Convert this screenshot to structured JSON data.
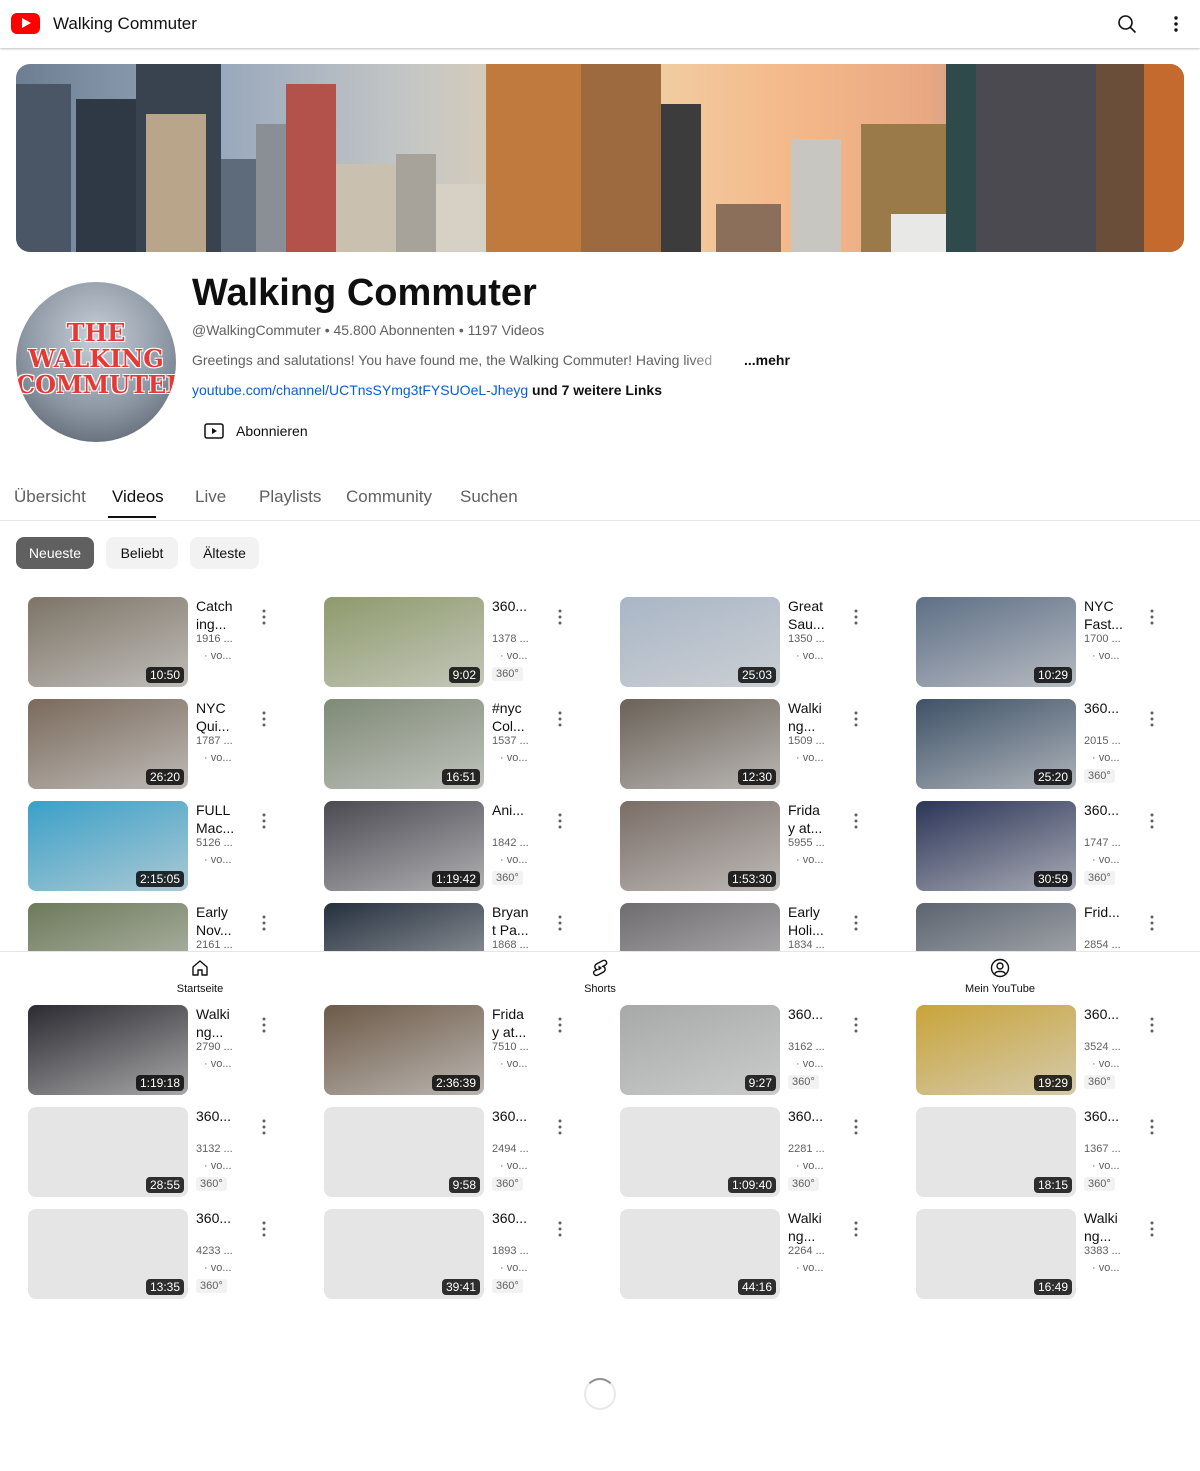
{
  "topbar": {
    "title": "Walking Commuter",
    "logo_icon": "youtube-logo-icon"
  },
  "channel": {
    "avatar_text": [
      "THE",
      "WALKING",
      "COMMUTER"
    ],
    "name": "Walking Commuter",
    "meta": "@WalkingCommuter • 45.800 Abonnenten • 1197 Videos",
    "description": "Greetings and salutations! You have found me, the Walking Commuter! Having lived",
    "more_label": "...mehr",
    "link_url": "youtube.com/channel/UCTnsSYmg3tFYSUOeL-Jheyg",
    "link_more": " und 7 weitere Links",
    "subscribe_label": "Abonnieren"
  },
  "tabs": [
    "Übersicht",
    "Videos",
    "Live",
    "Playlists",
    "Community",
    "Suchen"
  ],
  "active_tab": "Videos",
  "chips": [
    "Neueste",
    "Beliebt",
    "Älteste"
  ],
  "active_chip": "Neueste",
  "videos": [
    {
      "title": "Catch\ning...",
      "views": "1916 ...",
      "sub": "· vo...",
      "duration": "10:50",
      "badge": ""
    },
    {
      "title": "360...",
      "views": "1378 ...",
      "sub": "· vo...",
      "duration": "9:02",
      "badge": "360°"
    },
    {
      "title": "Great\nSau...",
      "views": "1350 ...",
      "sub": "· vo...",
      "duration": "25:03",
      "badge": ""
    },
    {
      "title": "NYC\nFast...",
      "views": "1700 ...",
      "sub": "· vo...",
      "duration": "10:29",
      "badge": ""
    },
    {
      "title": "NYC\nQui...",
      "views": "1787 ...",
      "sub": "· vo...",
      "duration": "26:20",
      "badge": ""
    },
    {
      "title": "#nyc\nCol...",
      "views": "1537 ...",
      "sub": "· vo...",
      "duration": "16:51",
      "badge": ""
    },
    {
      "title": "Walki\nng...",
      "views": "1509 ...",
      "sub": "· vo...",
      "duration": "12:30",
      "badge": ""
    },
    {
      "title": "360...",
      "views": "2015 ...",
      "sub": "· vo...",
      "duration": "25:20",
      "badge": "360°"
    },
    {
      "title": "FULL\nMac...",
      "views": "5126 ...",
      "sub": "· vo...",
      "duration": "2:15:05",
      "badge": ""
    },
    {
      "title": "Ani...",
      "views": "1842 ...",
      "sub": "· vo...",
      "duration": "1:19:42",
      "badge": "360°"
    },
    {
      "title": "Frida\ny at...",
      "views": "5955 ...",
      "sub": "· vo...",
      "duration": "1:53:30",
      "badge": ""
    },
    {
      "title": "360...",
      "views": "1747 ...",
      "sub": "· vo...",
      "duration": "30:59",
      "badge": "360°"
    },
    {
      "title": "Early\nNov...",
      "views": "2161 ...",
      "sub": "",
      "duration": "",
      "badge": ""
    },
    {
      "title": "Bryan\nt Pa...",
      "views": "1868 ...",
      "sub": "",
      "duration": "",
      "badge": ""
    },
    {
      "title": "Early\nHoli...",
      "views": "1834 ...",
      "sub": "",
      "duration": "",
      "badge": ""
    },
    {
      "title": "Frid...",
      "views": "2854 ...",
      "sub": "· vo...",
      "duration": "",
      "badge": ""
    },
    {
      "title": "Walki\nng...",
      "views": "2790 ...",
      "sub": "· vo...",
      "duration": "1:19:18",
      "badge": ""
    },
    {
      "title": "Frida\ny at...",
      "views": "7510 ...",
      "sub": "· vo...",
      "duration": "2:36:39",
      "badge": ""
    },
    {
      "title": "360...",
      "views": "3162 ...",
      "sub": "· vo...",
      "duration": "9:27",
      "badge": "360°"
    },
    {
      "title": "360...",
      "views": "3524 ...",
      "sub": "· vo...",
      "duration": "19:29",
      "badge": "360°"
    },
    {
      "title": "360...",
      "views": "3132 ...",
      "sub": "· vo...",
      "duration": "28:55",
      "badge": "360°"
    },
    {
      "title": "360...",
      "views": "2494 ...",
      "sub": "· vo...",
      "duration": "9:58",
      "badge": "360°"
    },
    {
      "title": "360...",
      "views": "2281 ...",
      "sub": "· vo...",
      "duration": "1:09:40",
      "badge": "360°"
    },
    {
      "title": "360...",
      "views": "1367 ...",
      "sub": "· vo...",
      "duration": "18:15",
      "badge": "360°"
    },
    {
      "title": "360...",
      "views": "4233 ...",
      "sub": "· vo...",
      "duration": "13:35",
      "badge": "360°"
    },
    {
      "title": "360...",
      "views": "1893 ...",
      "sub": "· vo...",
      "duration": "39:41",
      "badge": "360°"
    },
    {
      "title": "Walki\nng...",
      "views": "2264 ...",
      "sub": "· vo...",
      "duration": "44:16",
      "badge": ""
    },
    {
      "title": "Walki\nng...",
      "views": "3383 ...",
      "sub": "· vo...",
      "duration": "16:49",
      "badge": ""
    }
  ],
  "thumb_colors": [
    "#7d7466",
    "#8e9a6c",
    "#a9b6c6",
    "#5e6f86",
    "#7a6a5c",
    "#7f8a76",
    "#6b6258",
    "#3f5268",
    "#3aa0c8",
    "#4b4a52",
    "#7a6d66",
    "#2c3558",
    "#6d7a5a",
    "#25303e",
    "#6f6c70",
    "#5c6470",
    "#2b2a30",
    "#6d5a48",
    "#a7a9a8",
    "#c9a43a"
  ],
  "bottom_nav": [
    {
      "label": "Startseite",
      "icon": "home-icon"
    },
    {
      "label": "Shorts",
      "icon": "shorts-icon"
    },
    {
      "label": "Mein YouTube",
      "icon": "account-icon"
    }
  ],
  "colors": {
    "accent": "#ff0000",
    "link": "#065fd4",
    "chip_active": "#606060"
  }
}
